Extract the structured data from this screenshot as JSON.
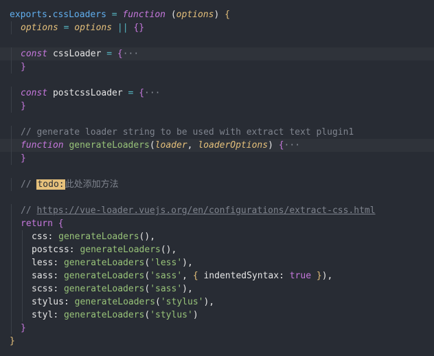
{
  "editor": {
    "lines": [
      {
        "tokens": [
          {
            "t": "exports",
            "c": "fn-blue"
          },
          {
            "t": ".",
            "c": "punc"
          },
          {
            "t": "cssLoaders",
            "c": "fn-blue"
          },
          {
            "t": " = ",
            "c": "op"
          },
          {
            "t": "function",
            "c": "kw-italic"
          },
          {
            "t": " (",
            "c": "punc"
          },
          {
            "t": "options",
            "c": "param"
          },
          {
            "t": ") ",
            "c": "punc"
          },
          {
            "t": "{",
            "c": "brace-yellow"
          }
        ]
      },
      {
        "indent": 1,
        "tokens": [
          {
            "t": "options",
            "c": "param"
          },
          {
            "t": " = ",
            "c": "op"
          },
          {
            "t": "options",
            "c": "param"
          },
          {
            "t": " || ",
            "c": "op"
          },
          {
            "t": "{}",
            "c": "brace-pink"
          }
        ]
      },
      {
        "tokens": []
      },
      {
        "indent": 1,
        "highlight": true,
        "tokens": [
          {
            "t": "const",
            "c": "kw-italic"
          },
          {
            "t": " cssLoader ",
            "c": "prop"
          },
          {
            "t": "= ",
            "c": "op"
          },
          {
            "t": "{",
            "c": "brace-pink"
          },
          {
            "t": "···",
            "c": "ellipsis"
          }
        ]
      },
      {
        "indent": 1,
        "tokens": [
          {
            "t": "}",
            "c": "brace-pink"
          }
        ]
      },
      {
        "tokens": []
      },
      {
        "indent": 1,
        "tokens": [
          {
            "t": "const",
            "c": "kw-italic"
          },
          {
            "t": " postcssLoader ",
            "c": "prop"
          },
          {
            "t": "= ",
            "c": "op"
          },
          {
            "t": "{",
            "c": "brace-pink"
          },
          {
            "t": "···",
            "c": "ellipsis"
          }
        ]
      },
      {
        "indent": 1,
        "tokens": [
          {
            "t": "}",
            "c": "brace-pink"
          }
        ]
      },
      {
        "tokens": []
      },
      {
        "indent": 1,
        "tokens": [
          {
            "t": "// generate loader string to be used with extract text plugin1",
            "c": "comment"
          }
        ]
      },
      {
        "indent": 1,
        "highlight": true,
        "tokens": [
          {
            "t": "function",
            "c": "kw-italic"
          },
          {
            "t": " ",
            "c": "punc"
          },
          {
            "t": "generateLoaders",
            "c": "fn"
          },
          {
            "t": "(",
            "c": "punc"
          },
          {
            "t": "loader",
            "c": "param"
          },
          {
            "t": ", ",
            "c": "punc"
          },
          {
            "t": "loaderOptions",
            "c": "param"
          },
          {
            "t": ") ",
            "c": "punc"
          },
          {
            "t": "{",
            "c": "brace-pink"
          },
          {
            "t": "···",
            "c": "ellipsis"
          }
        ]
      },
      {
        "indent": 1,
        "tokens": [
          {
            "t": "}",
            "c": "brace-pink"
          }
        ]
      },
      {
        "tokens": []
      },
      {
        "indent": 1,
        "tokens": [
          {
            "t": "// ",
            "c": "comment"
          },
          {
            "t": "todo:",
            "c": "todo-tag"
          },
          {
            "t": "此处添加方法",
            "c": "cjk"
          }
        ]
      },
      {
        "tokens": []
      },
      {
        "indent": 1,
        "tokens": [
          {
            "t": "// ",
            "c": "comment"
          },
          {
            "t": "https://vue-loader.vuejs.org/en/configurations/extract-css.html",
            "c": "comment-link"
          }
        ]
      },
      {
        "indent": 1,
        "tokens": [
          {
            "t": "return",
            "c": "kw"
          },
          {
            "t": " ",
            "c": "punc"
          },
          {
            "t": "{",
            "c": "brace-pink"
          }
        ]
      },
      {
        "indent": 2,
        "tokens": [
          {
            "t": "css",
            "c": "prop"
          },
          {
            "t": ": ",
            "c": "punc"
          },
          {
            "t": "generateLoaders",
            "c": "fn"
          },
          {
            "t": "(),",
            "c": "punc"
          }
        ]
      },
      {
        "indent": 2,
        "tokens": [
          {
            "t": "postcss",
            "c": "prop"
          },
          {
            "t": ": ",
            "c": "punc"
          },
          {
            "t": "generateLoaders",
            "c": "fn"
          },
          {
            "t": "(),",
            "c": "punc"
          }
        ]
      },
      {
        "indent": 2,
        "tokens": [
          {
            "t": "less",
            "c": "prop"
          },
          {
            "t": ": ",
            "c": "punc"
          },
          {
            "t": "generateLoaders",
            "c": "fn"
          },
          {
            "t": "(",
            "c": "punc"
          },
          {
            "t": "'less'",
            "c": "str"
          },
          {
            "t": "),",
            "c": "punc"
          }
        ]
      },
      {
        "indent": 2,
        "tokens": [
          {
            "t": "sass",
            "c": "prop"
          },
          {
            "t": ": ",
            "c": "punc"
          },
          {
            "t": "generateLoaders",
            "c": "fn"
          },
          {
            "t": "(",
            "c": "punc"
          },
          {
            "t": "'sass'",
            "c": "str"
          },
          {
            "t": ", ",
            "c": "punc"
          },
          {
            "t": "{",
            "c": "brace-yellow"
          },
          {
            "t": " indentedSyntax",
            "c": "prop"
          },
          {
            "t": ": ",
            "c": "punc"
          },
          {
            "t": "true",
            "c": "bool"
          },
          {
            "t": " ",
            "c": "punc"
          },
          {
            "t": "}",
            "c": "brace-yellow"
          },
          {
            "t": "),",
            "c": "punc"
          }
        ]
      },
      {
        "indent": 2,
        "tokens": [
          {
            "t": "scss",
            "c": "prop"
          },
          {
            "t": ": ",
            "c": "punc"
          },
          {
            "t": "generateLoaders",
            "c": "fn"
          },
          {
            "t": "(",
            "c": "punc"
          },
          {
            "t": "'sass'",
            "c": "str"
          },
          {
            "t": "),",
            "c": "punc"
          }
        ]
      },
      {
        "indent": 2,
        "tokens": [
          {
            "t": "stylus",
            "c": "prop"
          },
          {
            "t": ": ",
            "c": "punc"
          },
          {
            "t": "generateLoaders",
            "c": "fn"
          },
          {
            "t": "(",
            "c": "punc"
          },
          {
            "t": "'stylus'",
            "c": "str"
          },
          {
            "t": "),",
            "c": "punc"
          }
        ]
      },
      {
        "indent": 2,
        "tokens": [
          {
            "t": "styl",
            "c": "prop"
          },
          {
            "t": ": ",
            "c": "punc"
          },
          {
            "t": "generateLoaders",
            "c": "fn"
          },
          {
            "t": "(",
            "c": "punc"
          },
          {
            "t": "'stylus'",
            "c": "str"
          },
          {
            "t": ")",
            "c": "punc"
          }
        ]
      },
      {
        "indent": 1,
        "tokens": [
          {
            "t": "}",
            "c": "brace-pink"
          }
        ]
      },
      {
        "tokens": [
          {
            "t": "}",
            "c": "brace-yellow"
          }
        ]
      }
    ]
  }
}
